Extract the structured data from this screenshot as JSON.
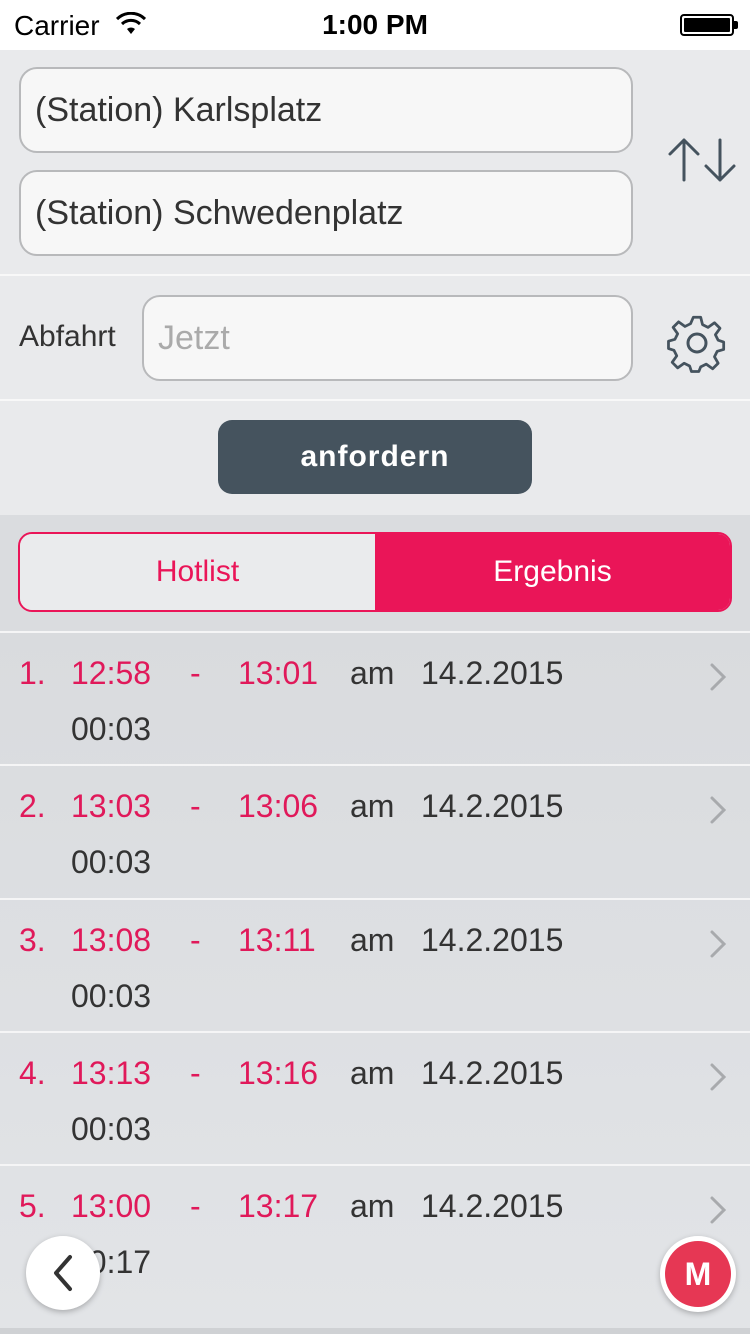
{
  "status_bar": {
    "carrier": "Carrier",
    "time": "1:00 PM"
  },
  "form": {
    "from_value": "(Station) Karlsplatz",
    "to_value": "(Station) Schwedenplatz",
    "departure_label": "Abfahrt",
    "time_placeholder": "Jetzt",
    "request_button": "anfordern",
    "swap_icon": "swap-arrows-icon",
    "settings_icon": "gear-icon"
  },
  "tabs": {
    "hotlist": "Hotlist",
    "ergebnis": "Ergebnis",
    "active": "ergebnis"
  },
  "results": [
    {
      "num": "1.",
      "dep": "12:58",
      "dash": "-",
      "arr": "13:01",
      "am": "am",
      "date": "14.2.2015",
      "duration": "00:03"
    },
    {
      "num": "2.",
      "dep": "13:03",
      "dash": "-",
      "arr": "13:06",
      "am": "am",
      "date": "14.2.2015",
      "duration": "00:03"
    },
    {
      "num": "3.",
      "dep": "13:08",
      "dash": "-",
      "arr": "13:11",
      "am": "am",
      "date": "14.2.2015",
      "duration": "00:03"
    },
    {
      "num": "4.",
      "dep": "13:13",
      "dash": "-",
      "arr": "13:16",
      "am": "am",
      "date": "14.2.2015",
      "duration": "00:03"
    },
    {
      "num": "5.",
      "dep": "13:00",
      "dash": "-",
      "arr": "13:17",
      "am": "am",
      "date": "14.2.2015",
      "duration": "00:17"
    }
  ],
  "fab": {
    "menu_letter": "M"
  },
  "colors": {
    "accent": "#ea1558",
    "button_dark": "#45535e",
    "fab_red": "#e63754"
  }
}
